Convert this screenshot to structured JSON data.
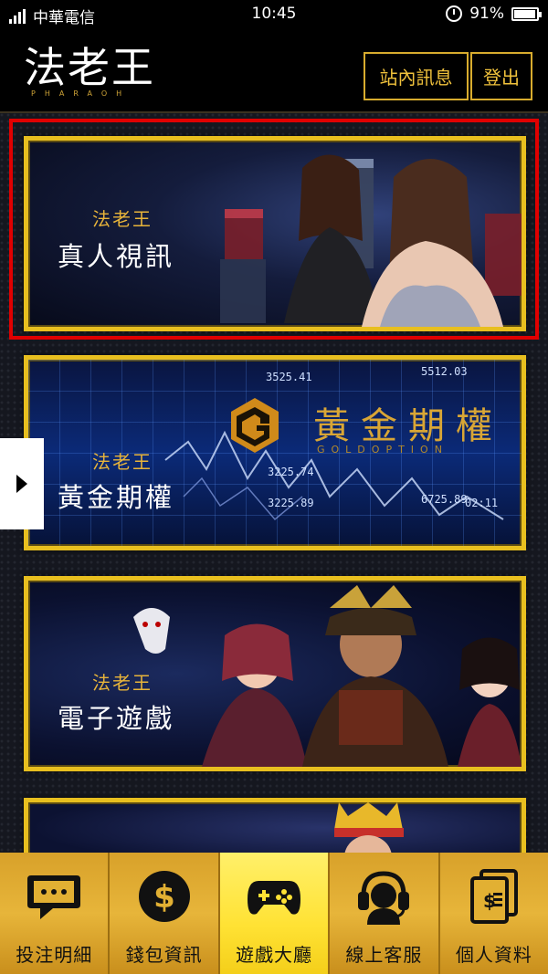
{
  "status_bar": {
    "carrier": "中華電信",
    "time": "10:45",
    "battery": "91%"
  },
  "header": {
    "logo_text": "法老王",
    "logo_sub": "PHARAOH",
    "messages_label": "站內訊息",
    "logout_label": "登出"
  },
  "cards": [
    {
      "brand": "法老王",
      "title": "真人視訊"
    },
    {
      "brand": "法老王",
      "title": "黃金期權",
      "logo_name": "黃金期權",
      "logo_sub": "GOLDOPTION",
      "tickers": [
        "5512.03",
        "3525.41",
        "3225.74",
        "3225.89",
        "6725.89",
        "02:11"
      ]
    },
    {
      "brand": "法老王",
      "title": "電子遊戲"
    }
  ],
  "bottom_nav": [
    {
      "label": "投注明細",
      "icon": "chat-bubble-icon"
    },
    {
      "label": "錢包資訊",
      "icon": "dollar-coin-icon"
    },
    {
      "label": "遊戲大廳",
      "icon": "gamepad-icon",
      "active": true
    },
    {
      "label": "線上客服",
      "icon": "headset-icon"
    },
    {
      "label": "個人資料",
      "icon": "document-dollar-icon"
    }
  ],
  "colors": {
    "gold": "#e8bf1f",
    "highlight": "#e00000",
    "nav_active": "#ffe234"
  }
}
